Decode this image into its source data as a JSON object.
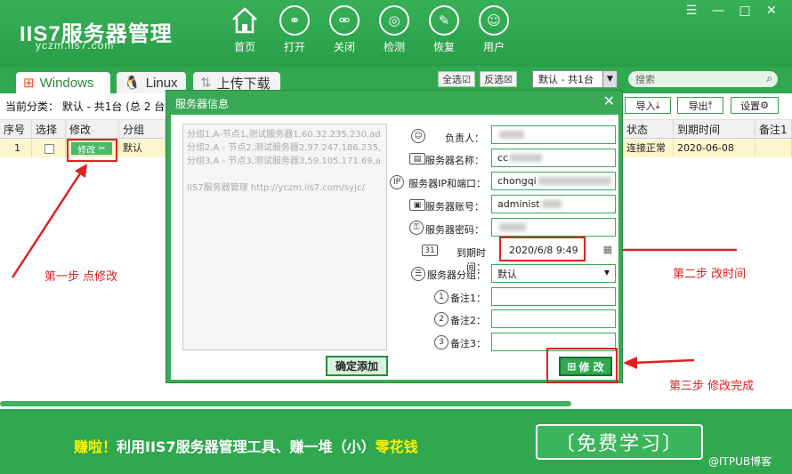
{
  "app": {
    "logo": "IIS7服务器管理",
    "url": "yczm.iis7.com"
  },
  "nav": [
    {
      "label": "首页",
      "icon": "home-icon"
    },
    {
      "label": "打开",
      "icon": "link-icon"
    },
    {
      "label": "关闭",
      "icon": "unlink-icon"
    },
    {
      "label": "检测",
      "icon": "radar-icon"
    },
    {
      "label": "恢复",
      "icon": "wrench-icon"
    },
    {
      "label": "用户",
      "icon": "user-icon"
    }
  ],
  "tabs": {
    "windows": "Windows",
    "linux": "Linux",
    "upload": "上传下载"
  },
  "toolbar": {
    "select_all": "全选",
    "invert": "反选",
    "group_selected": "默认 - 共1台",
    "search_placeholder": "搜索",
    "import": "导入",
    "export": "导出",
    "settings": "设置"
  },
  "category": "当前分类： 默认 - 共1台 (总 2 台",
  "table": {
    "headers": [
      "序号",
      "选择",
      "修改",
      "分组",
      "状态",
      "到期时间",
      "备注1"
    ],
    "row": {
      "index": "1",
      "edit": "修改",
      "group": "默认",
      "status": "连接正常",
      "expire": "2020-06-08"
    }
  },
  "dialog": {
    "title": "服务器信息",
    "text_lines": [
      "分组1,A-节点1,测试服务器1,60.32.235.230,ad",
      "分组2,A - 节点2,测试服务器2,97.247.186.235,",
      "分组3,A - 节点3,测试服务器3,59.105.171.69,a",
      "",
      "IIS7服务器管理 http://yczm.iis7.com/syjc/"
    ],
    "confirm_add": "确定添加",
    "modify": "修 改",
    "fields": [
      {
        "label": "负责人：",
        "value": ""
      },
      {
        "label": "服务器名称：",
        "value": "cc"
      },
      {
        "label": "服务器IP和端口：",
        "value": "chongqi"
      },
      {
        "label": "服务器账号：",
        "value": "administ"
      },
      {
        "label": "服务器密码：",
        "value": ""
      },
      {
        "label": "到期时间：",
        "value": "2020/6/8 9:49"
      },
      {
        "label": "服务器分组：",
        "value": "默认"
      },
      {
        "label": "备注1：",
        "value": ""
      },
      {
        "label": "备注2：",
        "value": ""
      },
      {
        "label": "备注3：",
        "value": ""
      }
    ]
  },
  "annotations": {
    "step1": "第一步 点修改",
    "step2": "第二步  改时间",
    "step3": "第三步 修改完成"
  },
  "footer": {
    "promo_prefix": "赚啦！",
    "promo_mid": "利用IIS7服务器管理工具、赚一堆（小）",
    "promo_suffix": "零花钱",
    "learn": "免费学习",
    "watermark": "@ITPUB博客"
  },
  "colors": {
    "brand_green": "#2fa84f",
    "annotation_red": "#e02020",
    "promo_yellow": "#fff000"
  }
}
